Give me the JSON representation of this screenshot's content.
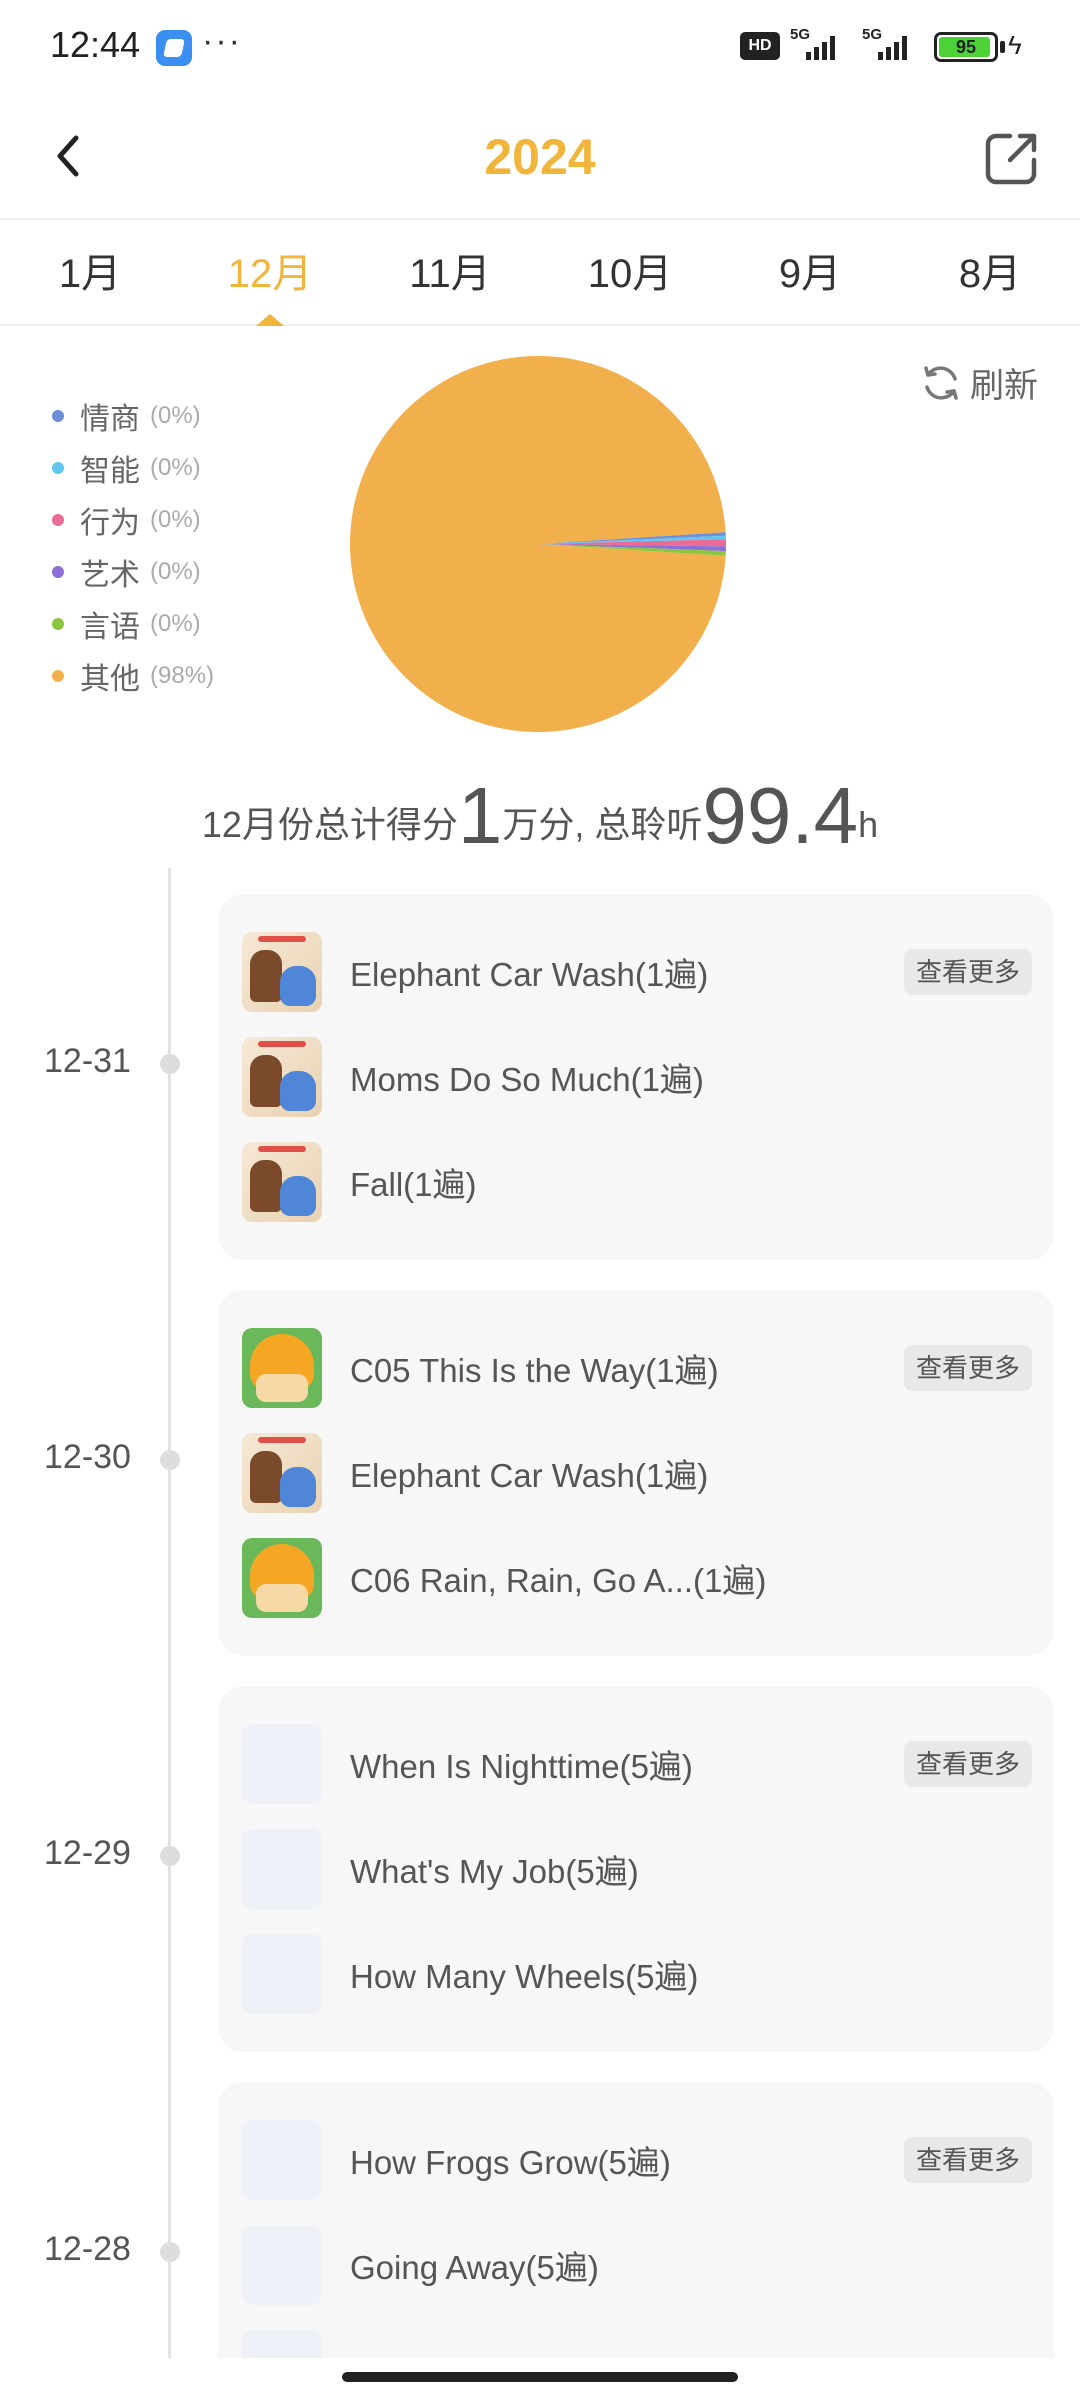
{
  "status_bar": {
    "time": "12:44",
    "dots": "···",
    "hd": "HD",
    "signal1": "5G",
    "signal2": "5G",
    "battery": "95"
  },
  "header": {
    "title": "2024",
    "back_icon": "chevron-left-icon",
    "share_icon": "share-external-icon"
  },
  "tabs": [
    {
      "label": "1月",
      "active": false
    },
    {
      "label": "12月",
      "active": true
    },
    {
      "label": "11月",
      "active": false
    },
    {
      "label": "10月",
      "active": false
    },
    {
      "label": "9月",
      "active": false
    },
    {
      "label": "8月",
      "active": false
    }
  ],
  "chart_data": {
    "type": "pie",
    "slices": [
      {
        "label": "情商",
        "value": 0.3,
        "pct_text": "(0%)",
        "color": "#6d8fd9"
      },
      {
        "label": "智能",
        "value": 0.3,
        "pct_text": "(0%)",
        "color": "#5fc7ef"
      },
      {
        "label": "行为",
        "value": 0.6,
        "pct_text": "(0%)",
        "color": "#ea6c95"
      },
      {
        "label": "艺术",
        "value": 0.4,
        "pct_text": "(0%)",
        "color": "#8b6fd6"
      },
      {
        "label": "言语",
        "value": 0.4,
        "pct_text": "(0%)",
        "color": "#8cc63f"
      },
      {
        "label": "其他",
        "value": 98,
        "pct_text": "(98%)",
        "color": "#f2b04c"
      }
    ]
  },
  "refresh": {
    "label": "刷新",
    "icon": "refresh-icon"
  },
  "summary": {
    "prefix": "12月份总计得分",
    "score": "1",
    "score_unit": "万分, 总聆听",
    "hours": "99.4",
    "hours_unit": "h"
  },
  "more_label": "查看更多",
  "days": [
    {
      "date": "12-31",
      "records": [
        {
          "title": "Elephant Car Wash(1遍)",
          "thumb": "a"
        },
        {
          "title": "Moms Do So Much(1遍)",
          "thumb": "a"
        },
        {
          "title": "Fall(1遍)",
          "thumb": "a"
        }
      ]
    },
    {
      "date": "12-30",
      "records": [
        {
          "title": "C05 This Is the Way(1遍)",
          "thumb": "b"
        },
        {
          "title": "Elephant Car Wash(1遍)",
          "thumb": "a"
        },
        {
          "title": "C06 Rain, Rain, Go A...(1遍)",
          "thumb": "b"
        }
      ]
    },
    {
      "date": "12-29",
      "records": [
        {
          "title": "When Is Nighttime(5遍)",
          "thumb": "empty"
        },
        {
          "title": "What's My Job(5遍)",
          "thumb": "empty"
        },
        {
          "title": "How Many Wheels(5遍)",
          "thumb": "empty"
        }
      ]
    },
    {
      "date": "12-28",
      "records": [
        {
          "title": "How Frogs Grow(5遍)",
          "thumb": "empty"
        },
        {
          "title": "Going Away(5遍)",
          "thumb": "empty"
        },
        {
          "title": "",
          "thumb": "empty"
        }
      ]
    }
  ]
}
